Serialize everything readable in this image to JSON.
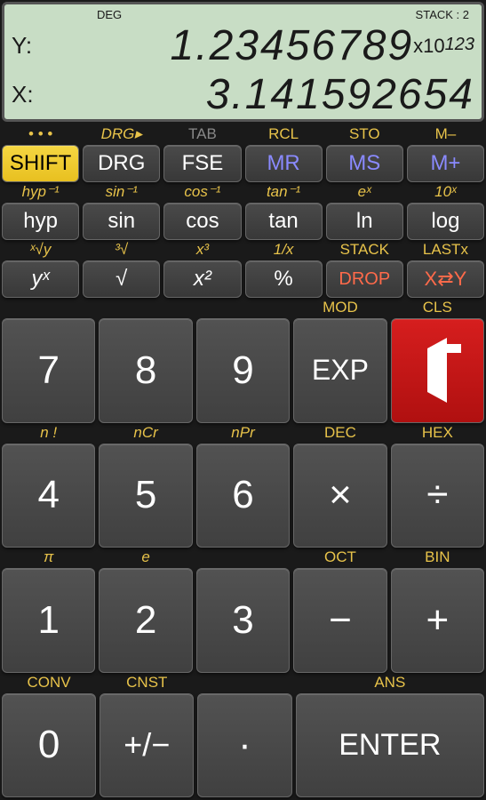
{
  "display": {
    "deg": "DEG",
    "stack": "STACK : 2",
    "y_label": "Y:",
    "y_value": "1.23456789",
    "y_exp_prefix": "x10",
    "y_exp": "123",
    "x_label": "X:",
    "x_value": "3.141592654"
  },
  "rows": {
    "r1": {
      "shift": [
        "• • •",
        "DRG▸",
        "TAB",
        "RCL",
        "STO",
        "M–"
      ],
      "btn": [
        "SHIFT",
        "DRG",
        "FSE",
        "MR",
        "MS",
        "M+"
      ]
    },
    "r2": {
      "shift": [
        "hyp⁻¹",
        "sin⁻¹",
        "cos⁻¹",
        "tan⁻¹",
        "eˣ",
        "10ˣ"
      ],
      "btn": [
        "hyp",
        "sin",
        "cos",
        "tan",
        "ln",
        "log"
      ]
    },
    "r3": {
      "shift": [
        "ˣ√y",
        "³√",
        "x³",
        "1/x",
        "STACK",
        "LASTx"
      ],
      "btn": [
        "yˣ",
        "√",
        "x²",
        "%",
        "DROP",
        "X⇄Y"
      ]
    },
    "r4": {
      "shift": [
        "",
        "",
        "",
        "MOD",
        "CLS"
      ],
      "btn": [
        "7",
        "8",
        "9",
        "EXP",
        "←"
      ]
    },
    "r5": {
      "shift": [
        "n !",
        "nCr",
        "nPr",
        "DEC",
        "HEX"
      ],
      "btn": [
        "4",
        "5",
        "6",
        "×",
        "÷"
      ]
    },
    "r6": {
      "shift": [
        "π",
        "e",
        "",
        "OCT",
        "BIN"
      ],
      "btn": [
        "1",
        "2",
        "3",
        "−",
        "+"
      ]
    },
    "r7": {
      "shift": [
        "CONV",
        "CNST",
        "",
        "ANS"
      ],
      "btn": [
        "0",
        "+/−",
        "·",
        "ENTER"
      ]
    }
  }
}
